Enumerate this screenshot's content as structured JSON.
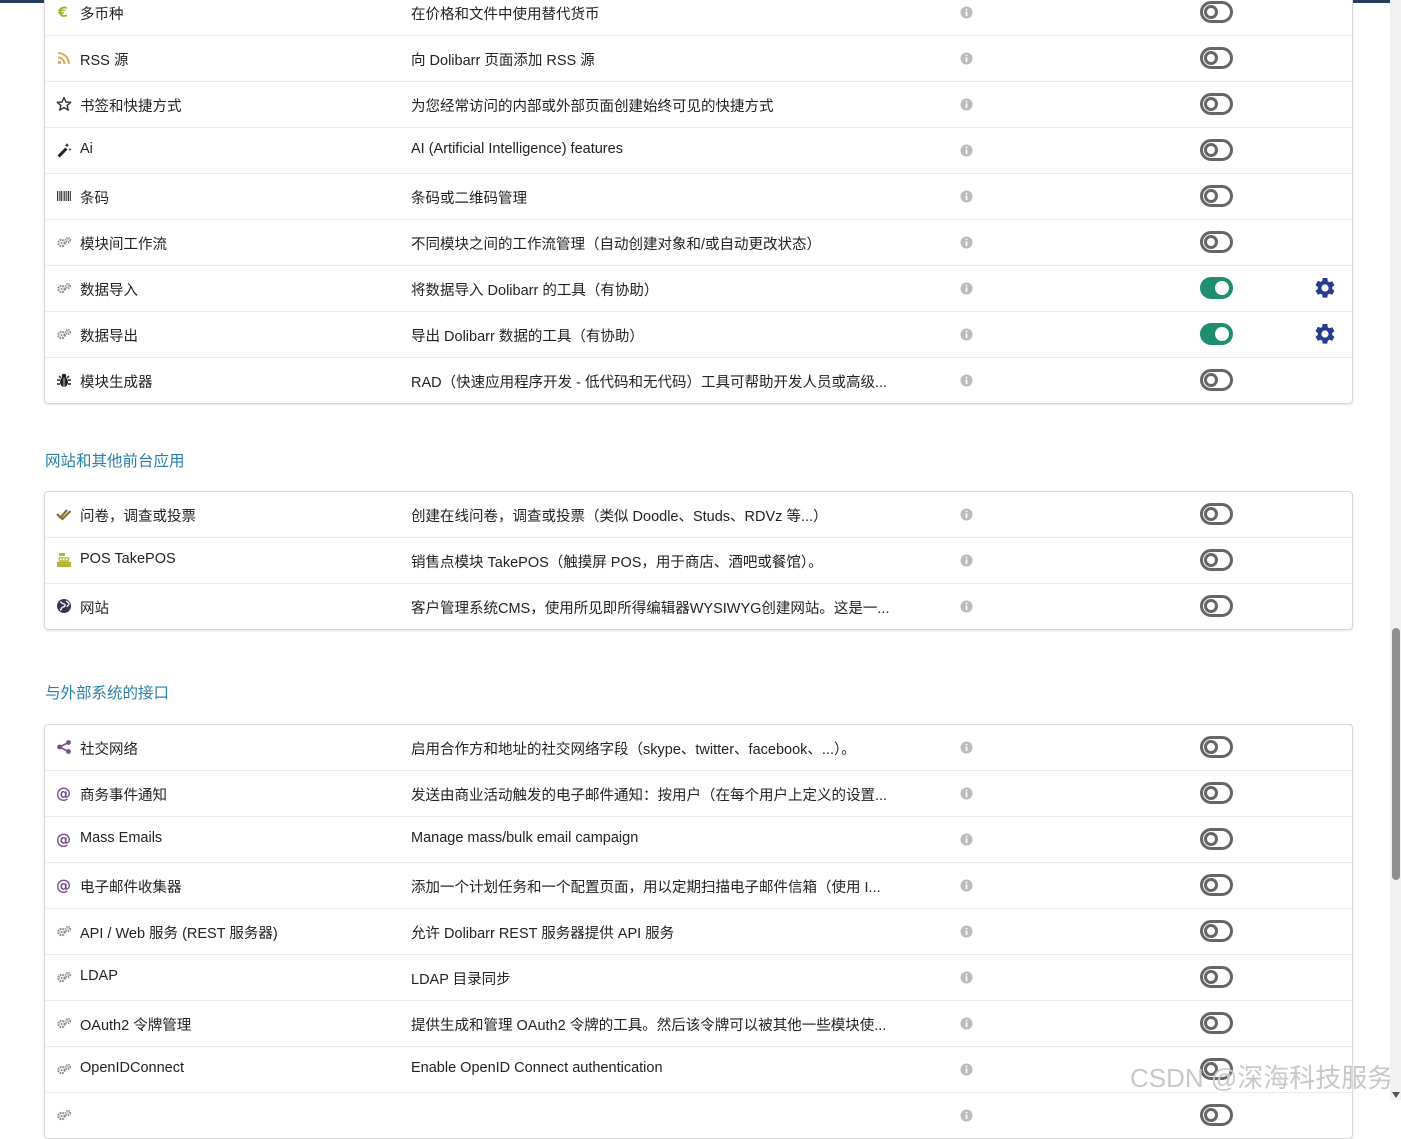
{
  "sections": [
    {
      "title": "",
      "rows": [
        {
          "name": "多币种",
          "desc": "在价格和文件中使用替代货币",
          "icon": "euro-icon",
          "enabled": false
        },
        {
          "name": "RSS 源",
          "desc": "向 Dolibarr 页面添加 RSS 源",
          "icon": "rss-icon",
          "enabled": false
        },
        {
          "name": "书签和快捷方式",
          "desc": "为您经常访问的内部或外部页面创建始终可见的快捷方式",
          "icon": "star-icon",
          "enabled": false
        },
        {
          "name": "Ai",
          "desc": "AI (Artificial Intelligence) features",
          "icon": "magic-wand-icon",
          "enabled": false
        },
        {
          "name": "条码",
          "desc": "条码或二维码管理",
          "icon": "barcode-icon",
          "enabled": false
        },
        {
          "name": "模块间工作流",
          "desc": "不同模块之间的工作流管理（自动创建对象和/或自动更改状态）",
          "icon": "cogs-icon",
          "enabled": false
        },
        {
          "name": "数据导入",
          "desc": "将数据导入 Dolibarr 的工具（有协助）",
          "icon": "cogs-icon",
          "enabled": true
        },
        {
          "name": "数据导出",
          "desc": "导出 Dolibarr 数据的工具（有协助）",
          "icon": "cogs-icon",
          "enabled": true
        },
        {
          "name": "模块生成器",
          "desc": "RAD（快速应用程序开发 - 低代码和无代码）工具可帮助开发人员或高级...",
          "icon": "bug-icon",
          "enabled": false
        }
      ]
    },
    {
      "title": "网站和其他前台应用",
      "rows": [
        {
          "name": "问卷，调查或投票",
          "desc": "创建在线问卷，调查或投票（类似 Doodle、Studs、RDVz 等...）",
          "icon": "check-double-icon",
          "enabled": false
        },
        {
          "name": "POS TakePOS",
          "desc": "销售点模块 TakePOS（触摸屏 POS，用于商店、酒吧或餐馆）。",
          "icon": "cash-register-icon",
          "enabled": false
        },
        {
          "name": "网站",
          "desc": "客户管理系统CMS，使用所见即所得编辑器WYSIWYG创建网站。这是一...",
          "icon": "globe-icon",
          "enabled": false
        }
      ]
    },
    {
      "title": "与外部系统的接口",
      "rows": [
        {
          "name": "社交网络",
          "desc": "启用合作方和地址的社交网络字段（skype、twitter、facebook、...）。",
          "icon": "share-icon",
          "enabled": false
        },
        {
          "name": "商务事件通知",
          "desc": "发送由商业活动触发的电子邮件通知：按用户（在每个用户上定义的设置...",
          "icon": "at-icon",
          "enabled": false
        },
        {
          "name": "Mass Emails",
          "desc": "Manage mass/bulk email campaign",
          "icon": "at-icon",
          "enabled": false
        },
        {
          "name": "电子邮件收集器",
          "desc": "添加一个计划任务和一个配置页面，用以定期扫描电子邮件信箱（使用 I...",
          "icon": "at-icon",
          "enabled": false
        },
        {
          "name": "API / Web 服务 (REST 服务器)",
          "desc": "允许 Dolibarr REST 服务器提供 API 服务",
          "icon": "cogs-icon",
          "enabled": false
        },
        {
          "name": "LDAP",
          "desc": "LDAP 目录同步",
          "icon": "cogs-icon",
          "enabled": false
        },
        {
          "name": "OAuth2 令牌管理",
          "desc": "提供生成和管理 OAuth2 令牌的工具。然后该令牌可以被其他一些模块使...",
          "icon": "cogs-icon",
          "enabled": false
        },
        {
          "name": "OpenIDConnect",
          "desc": "Enable OpenID Connect authentication",
          "icon": "cogs-icon",
          "enabled": false
        },
        {
          "name": "",
          "desc": "",
          "icon": "cogs-icon",
          "enabled": false
        }
      ]
    }
  ],
  "watermark": "CSDN @深海科技服务",
  "colors": {
    "accent": "#2a7fa8",
    "toggle_on": "#1e8e6e",
    "toggle_off": "#666666",
    "gear": "#263c8c",
    "info": "#bbbbbb"
  }
}
